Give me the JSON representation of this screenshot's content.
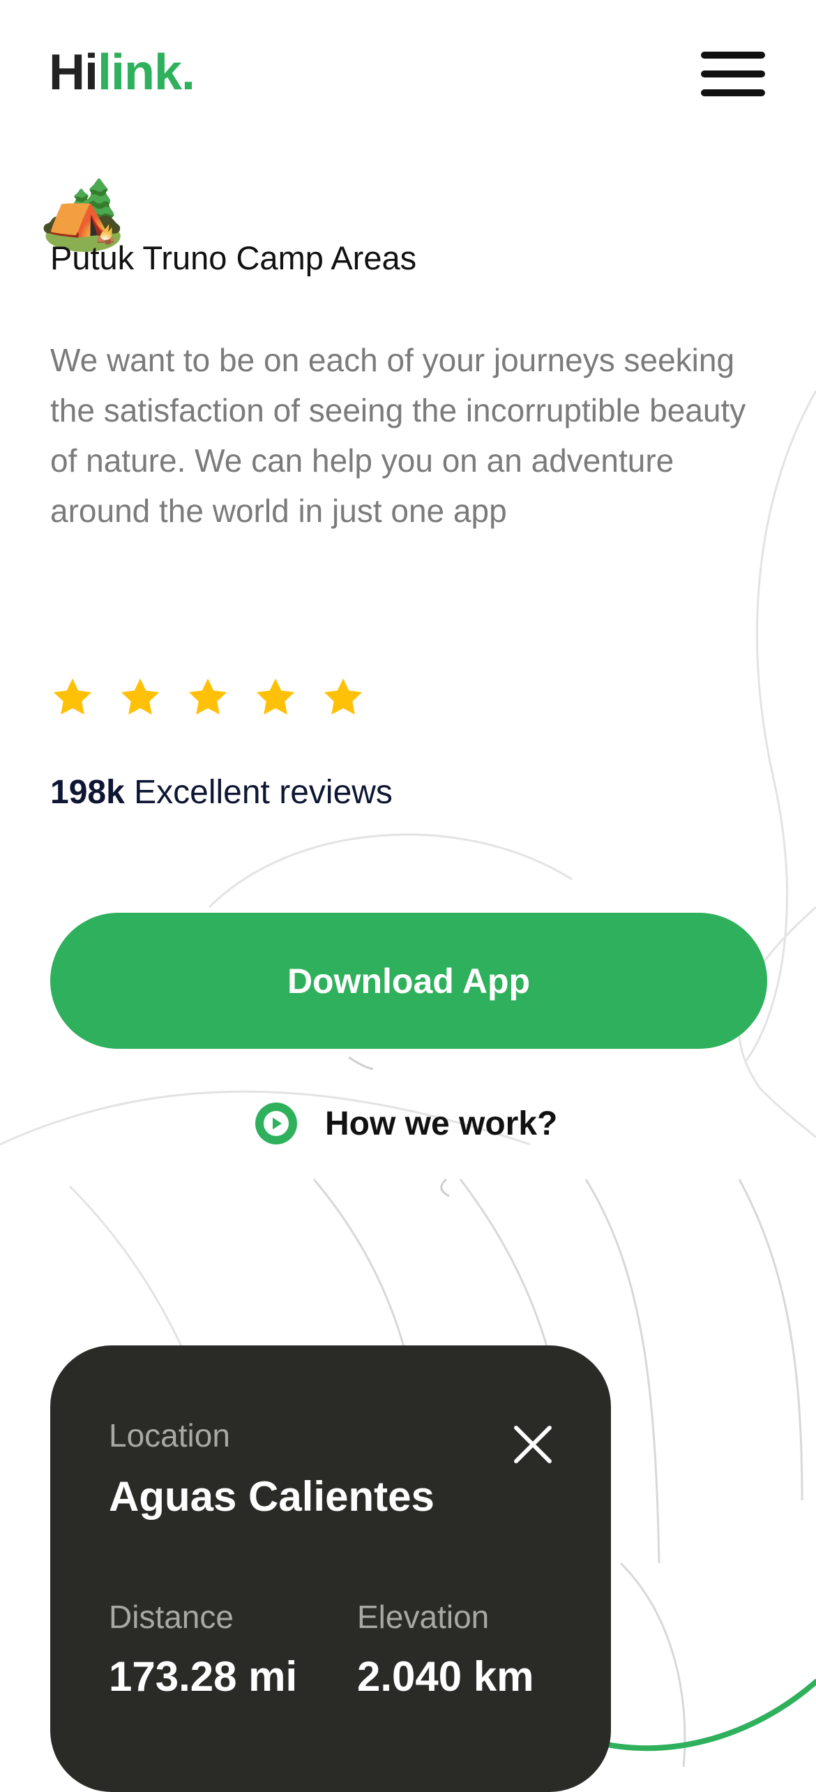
{
  "brand": {
    "logo_prefix": "Hi",
    "logo_suffix": "link.",
    "accent_color": "#2fb05c"
  },
  "header": {
    "menu_icon": "hamburger-menu-icon"
  },
  "hero": {
    "emoji": "🏕️",
    "headline": "Putuk Truno Camp Areas",
    "description": "We want to be on each of your journeys seeking the satisfaction of seeing the incorruptible beauty of nature. We can help you on an adventure around the world in just one app"
  },
  "rating": {
    "stars": 5,
    "star_color": "#ffc107",
    "count": "198k",
    "label": "Excellent reviews"
  },
  "actions": {
    "download_label": "Download App",
    "how_label": "How we work?",
    "how_icon": "play-circle-icon"
  },
  "location_card": {
    "location_key": "Location",
    "location_value": "Aguas Calientes",
    "distance_key": "Distance",
    "distance_value": "173.28 mi",
    "elevation_key": "Elevation",
    "elevation_value": "2.040 km",
    "close_icon": "close-icon"
  }
}
